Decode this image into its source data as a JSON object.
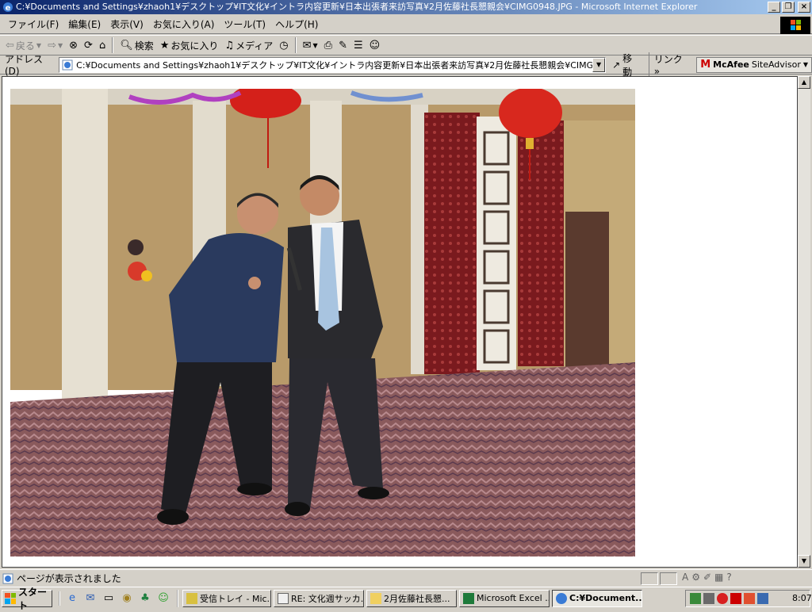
{
  "window": {
    "title": "C:¥Documents and Settings¥zhaoh1¥デスクトップ¥IT文化¥イントラ内容更新¥日本出張者来訪写真¥2月佐藤社長懇親会¥CIMG0948.JPG - Microsoft Internet Explorer",
    "minimize": "_",
    "restore": "❐",
    "close": "×"
  },
  "menu": [
    "ファイル(F)",
    "編集(E)",
    "表示(V)",
    "お気に入り(A)",
    "ツール(T)",
    "ヘルプ(H)"
  ],
  "toolbar": {
    "back": "戻る",
    "search": "検索",
    "favorites": "お気に入り",
    "media": "メディア"
  },
  "address": {
    "label": "アドレス(D)",
    "value": "C:¥Documents and Settings¥zhaoh1¥デスクトップ¥IT文化¥イントラ内容更新¥日本出張者来訪写真¥2月佐藤社長懇親会¥CIMG0948.JPG",
    "go": "移動",
    "links": "リンク »",
    "mcafee_brand": "McAfee",
    "mcafee_product": "SiteAdvisor"
  },
  "status": {
    "text": "ページが表示されました"
  },
  "taskbar": {
    "start": "スタート",
    "tasks": [
      {
        "label": "受信トレイ - Mic...",
        "icon": "outlook-icon",
        "active": false
      },
      {
        "label": "RE: 文化週サッカ...",
        "icon": "mail-icon",
        "active": false
      },
      {
        "label": "2月佐藤社長懇...",
        "icon": "folder-icon",
        "active": false
      },
      {
        "label": "Microsoft Excel ...",
        "icon": "excel-icon",
        "active": false
      },
      {
        "label": "C:¥Document...",
        "icon": "ie-icon",
        "active": true
      }
    ],
    "clock": "8:07"
  },
  "colors": {
    "title_gradient_start": "#0a246a",
    "title_gradient_end": "#a6caf0",
    "chrome": "#d4d0c8"
  }
}
